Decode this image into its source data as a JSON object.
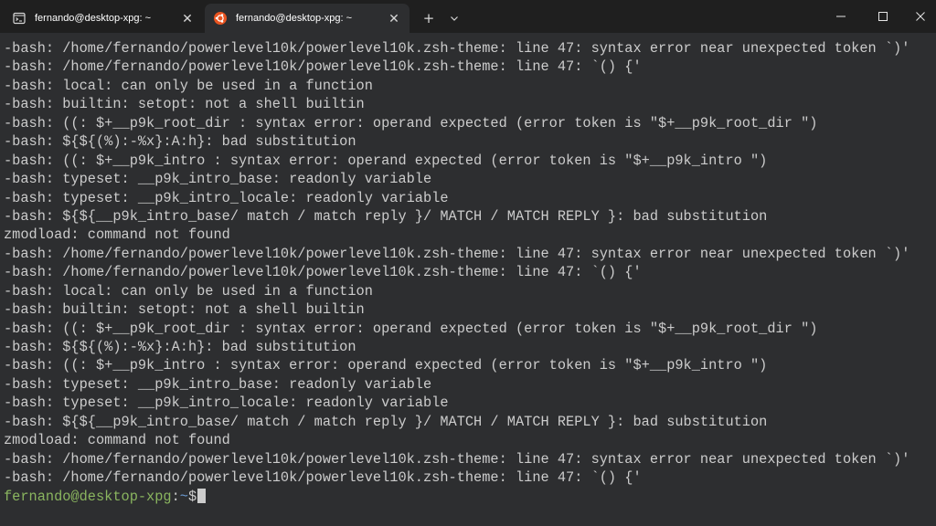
{
  "tabs": [
    {
      "title": "fernando@desktop-xpg: ~",
      "icon": "terminal-icon",
      "active": false
    },
    {
      "title": "fernando@desktop-xpg: ~",
      "icon": "ubuntu-icon",
      "active": true
    }
  ],
  "toolbar": {
    "new_tab": "+",
    "dropdown": "⌄"
  },
  "window_controls": {
    "minimize": "—",
    "maximize": "☐",
    "close": "✕"
  },
  "terminal": {
    "lines": [
      "-bash: /home/fernando/powerlevel10k/powerlevel10k.zsh-theme: line 47: syntax error near unexpected token `)'",
      "-bash: /home/fernando/powerlevel10k/powerlevel10k.zsh-theme: line 47: `() {'",
      "-bash: local: can only be used in a function",
      "-bash: builtin: setopt: not a shell builtin",
      "-bash: ((: $+__p9k_root_dir : syntax error: operand expected (error token is \"$+__p9k_root_dir \")",
      "-bash: ${${(%):-%x}:A:h}: bad substitution",
      "-bash: ((: $+__p9k_intro : syntax error: operand expected (error token is \"$+__p9k_intro \")",
      "-bash: typeset: __p9k_intro_base: readonly variable",
      "-bash: typeset: __p9k_intro_locale: readonly variable",
      "-bash: ${${__p9k_intro_base/ match / match reply }/ MATCH / MATCH REPLY }: bad substitution",
      "zmodload: command not found",
      "-bash: /home/fernando/powerlevel10k/powerlevel10k.zsh-theme: line 47: syntax error near unexpected token `)'",
      "-bash: /home/fernando/powerlevel10k/powerlevel10k.zsh-theme: line 47: `() {'",
      "-bash: local: can only be used in a function",
      "-bash: builtin: setopt: not a shell builtin",
      "-bash: ((: $+__p9k_root_dir : syntax error: operand expected (error token is \"$+__p9k_root_dir \")",
      "-bash: ${${(%):-%x}:A:h}: bad substitution",
      "-bash: ((: $+__p9k_intro : syntax error: operand expected (error token is \"$+__p9k_intro \")",
      "-bash: typeset: __p9k_intro_base: readonly variable",
      "-bash: typeset: __p9k_intro_locale: readonly variable",
      "-bash: ${${__p9k_intro_base/ match / match reply }/ MATCH / MATCH REPLY }: bad substitution",
      "zmodload: command not found",
      "-bash: /home/fernando/powerlevel10k/powerlevel10k.zsh-theme: line 47: syntax error near unexpected token `)'",
      "-bash: /home/fernando/powerlevel10k/powerlevel10k.zsh-theme: line 47: `() {'"
    ],
    "prompt": {
      "user_host": "fernando@desktop-xpg",
      "separator": ":",
      "path": "~",
      "symbol": "$"
    }
  },
  "colors": {
    "background": "#2d2e30",
    "titlebar": "#1f1f1f",
    "text": "#cccccc",
    "prompt_user": "#8ab55f",
    "prompt_path": "#6c9bd2",
    "ubuntu_orange": "#e95420"
  }
}
